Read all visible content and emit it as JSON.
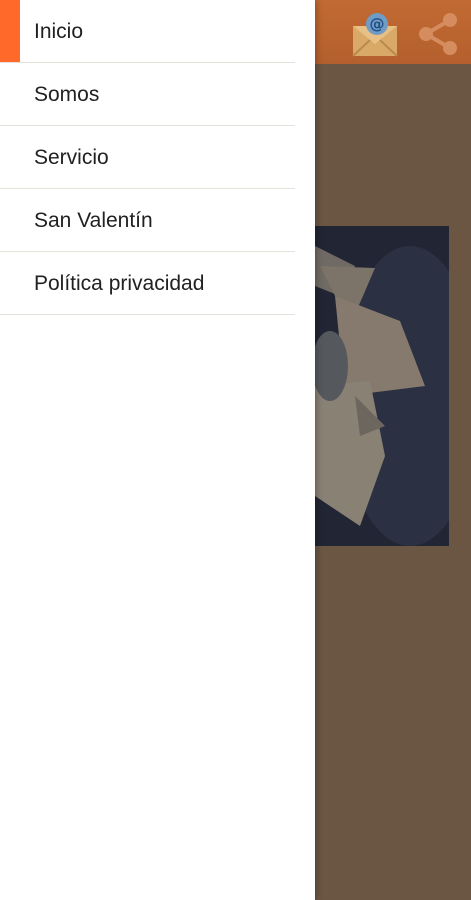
{
  "colors": {
    "accent": "#ff6a2b",
    "toolbar": "#c26a33",
    "scrim_background": "#6b5643",
    "drawer_background": "#ffffff"
  },
  "toolbar": {
    "actions": [
      {
        "icon": "email-icon"
      },
      {
        "icon": "share-icon"
      }
    ]
  },
  "drawer": {
    "items": [
      {
        "label": "Inicio",
        "active": true
      },
      {
        "label": "Somos"
      },
      {
        "label": "Servicio"
      },
      {
        "label": "San Valentín"
      },
      {
        "label": "Política privacidad"
      }
    ]
  }
}
